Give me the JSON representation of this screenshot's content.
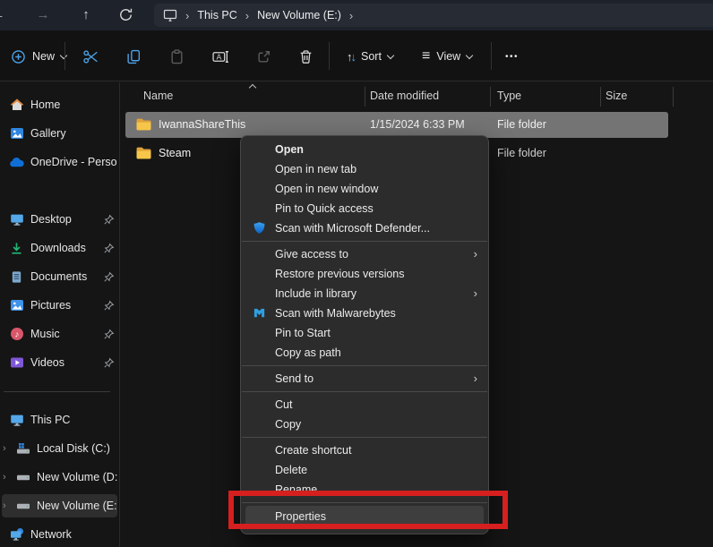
{
  "colors": {
    "navbar_background": "#1e222b",
    "address_field": "#262b34",
    "toolbar_background": "#121212",
    "selection_gray": "#747474",
    "accent_blue": "#4da3e8",
    "annotation_red": "#d61f1f",
    "menu_background": "#2c2c2c"
  },
  "navbar": {
    "icons": [
      "back-arrow",
      "forward-arrow",
      "up-arrow",
      "refresh"
    ],
    "breadcrumb": [
      "This PC",
      "New Volume (E:)"
    ]
  },
  "toolbar": {
    "new_label": "New",
    "sort_label": "Sort",
    "view_label": "View",
    "sort_glyph": "↑↓",
    "view_glyph": "≡",
    "more_glyph": "•••",
    "icons": [
      "new-plus",
      "cut-scissors",
      "copy",
      "paste",
      "rename",
      "share",
      "delete-trash",
      "sort",
      "view",
      "more"
    ]
  },
  "sidebar": {
    "top": [
      {
        "label": "Home",
        "icon": "home"
      },
      {
        "label": "Gallery",
        "icon": "gallery"
      },
      {
        "label": "OneDrive - Persona",
        "icon": "onedrive-cloud"
      }
    ],
    "pinned": [
      {
        "label": "Desktop",
        "icon": "desktop-monitor"
      },
      {
        "label": "Downloads",
        "icon": "download-arrow"
      },
      {
        "label": "Documents",
        "icon": "document"
      },
      {
        "label": "Pictures",
        "icon": "picture"
      },
      {
        "label": "Music",
        "icon": "music-note"
      },
      {
        "label": "Videos",
        "icon": "video-play"
      }
    ],
    "tree": [
      {
        "label": "This PC",
        "icon": "this-pc-monitor",
        "selected": false
      },
      {
        "label": "Local Disk (C:)",
        "icon": "system-drive",
        "selected": false
      },
      {
        "label": "New Volume (D:)",
        "icon": "drive",
        "selected": false
      },
      {
        "label": "New Volume (E:)",
        "icon": "drive",
        "selected": true
      },
      {
        "label": "Network",
        "icon": "network",
        "selected": false
      }
    ]
  },
  "list": {
    "columns": [
      "Name",
      "Date modified",
      "Type",
      "Size"
    ],
    "sort_column": "Name",
    "sort_direction": "ascending",
    "rows": [
      {
        "name": "IwannaShareThis",
        "date_modified": "1/15/2024 6:33 PM",
        "type": "File folder",
        "size": "",
        "selected": true
      },
      {
        "name": "Steam",
        "date_modified": "",
        "type": "File folder",
        "size": "",
        "selected": false
      }
    ]
  },
  "context_menu": {
    "groups": [
      {
        "items": [
          {
            "label": "Open",
            "bold": true
          },
          {
            "label": "Open in new tab"
          },
          {
            "label": "Open in new window"
          },
          {
            "label": "Pin to Quick access"
          },
          {
            "label": "Scan with Microsoft Defender...",
            "icon": "defender-shield"
          }
        ]
      },
      {
        "items": [
          {
            "label": "Give access to",
            "submenu": true
          },
          {
            "label": "Restore previous versions"
          },
          {
            "label": "Include in library",
            "submenu": true
          },
          {
            "label": "Scan with Malwarebytes",
            "icon": "malwarebytes"
          },
          {
            "label": "Pin to Start"
          },
          {
            "label": "Copy as path"
          }
        ]
      },
      {
        "items": [
          {
            "label": "Send to",
            "submenu": true
          }
        ]
      },
      {
        "items": [
          {
            "label": "Cut"
          },
          {
            "label": "Copy"
          }
        ]
      },
      {
        "items": [
          {
            "label": "Create shortcut"
          },
          {
            "label": "Delete"
          },
          {
            "label": "Rename"
          }
        ]
      },
      {
        "items": [
          {
            "label": "Properties",
            "highlighted": true
          }
        ]
      }
    ]
  },
  "annotation": {
    "shape": "red-rectangle",
    "target": "Properties"
  }
}
